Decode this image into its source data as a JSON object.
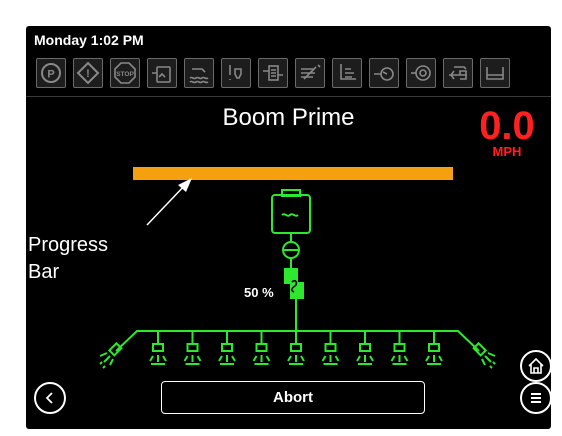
{
  "status": {
    "clock": "Monday 1:02 PM"
  },
  "indicators": [
    {
      "icon": "parking-brake-icon",
      "text": "P"
    },
    {
      "icon": "warning-icon",
      "text": "!"
    },
    {
      "icon": "stop-icon",
      "text": "STOP"
    },
    {
      "icon": "tank-icon"
    },
    {
      "icon": "rinse-icon"
    },
    {
      "icon": "nozzle-alert-icon"
    },
    {
      "icon": "filter-icon"
    },
    {
      "icon": "flow-off-icon"
    },
    {
      "icon": "boom-height-icon"
    },
    {
      "icon": "pump-icon"
    },
    {
      "icon": "agitator-icon"
    },
    {
      "icon": "valve-icon"
    },
    {
      "icon": "boom-fold-icon"
    }
  ],
  "main": {
    "title": "Boom Prime",
    "speed_value": "0.0",
    "speed_unit": "MPH",
    "progress_fraction": 1.0,
    "pump_percent": "50 %",
    "nozzle_count": 9
  },
  "footer": {
    "abort_label": "Abort"
  },
  "annotation": {
    "bullet": "•",
    "line1": "Progress",
    "line2": "Bar"
  },
  "colors": {
    "progress": "#f5a10f",
    "plumbing": "#2ee82e",
    "speed": "#ff2020"
  }
}
